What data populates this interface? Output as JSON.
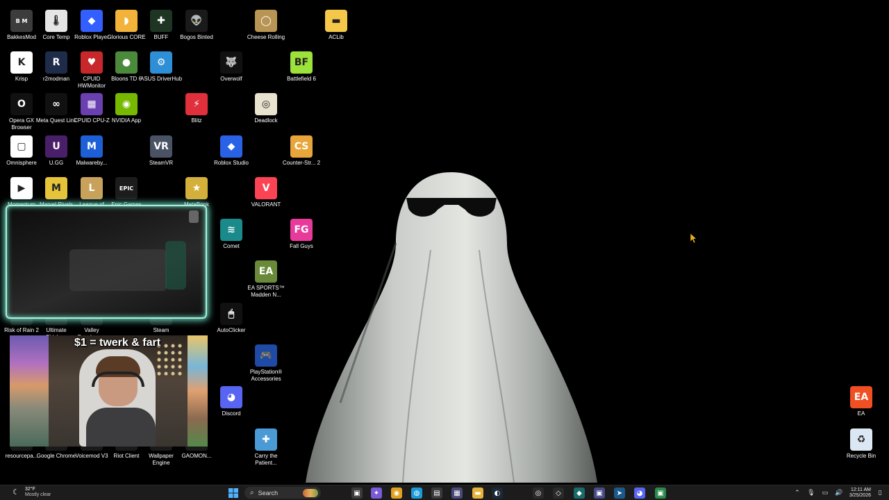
{
  "desktop": {
    "icons": [
      {
        "label": "BakkesMod",
        "glyph": "B M",
        "color": "#3c3c3c"
      },
      {
        "label": "Core Temp",
        "glyph": "🌡",
        "color": "#e5e5e5"
      },
      {
        "label": "Roblox Player",
        "glyph": "◆",
        "color": "#335fff"
      },
      {
        "label": "Glorious CORE",
        "glyph": "◗",
        "color": "#f3b23a"
      },
      {
        "label": "BUFF",
        "glyph": "✚",
        "color": "#1f3524"
      },
      {
        "label": "Bogos Binted",
        "glyph": "👽",
        "color": "#1a1a1a"
      },
      {
        "label": "Cheese Rolling",
        "glyph": "◯",
        "color": "#b89455"
      },
      {
        "label": "ACLib",
        "glyph": "▬",
        "color": "#f5c84a"
      },
      {
        "label": "Krisp",
        "glyph": "K",
        "color": "#ffffff"
      },
      {
        "label": "r2modman",
        "glyph": "R",
        "color": "#1e2c4a"
      },
      {
        "label": "CPUID HWMonitor",
        "glyph": "♥",
        "color": "#c8282b"
      },
      {
        "label": "Bloons TD 6",
        "glyph": "●",
        "color": "#4a8a3a"
      },
      {
        "label": "ASUS DriverHub",
        "glyph": "⚙",
        "color": "#2f8fd6"
      },
      {
        "label": "Overwolf",
        "glyph": "🐺",
        "color": "#111111"
      },
      {
        "label": "Battlefield 6",
        "glyph": "BF",
        "color": "#9de23a"
      },
      {
        "label": "Opera GX Browser",
        "glyph": "O",
        "color": "#111111"
      },
      {
        "label": "Meta Quest Link",
        "glyph": "∞",
        "color": "#111111"
      },
      {
        "label": "CPUID CPU-Z",
        "glyph": "▦",
        "color": "#6a3fb0"
      },
      {
        "label": "NVIDIA App",
        "glyph": "◉",
        "color": "#76b900"
      },
      {
        "label": "Blitz",
        "glyph": "⚡",
        "color": "#e0303c"
      },
      {
        "label": "Deadlock",
        "glyph": "◎",
        "color": "#e8e2cf"
      },
      {
        "label": "Omnisphere",
        "glyph": "▢",
        "color": "#ffffff"
      },
      {
        "label": "U.GG",
        "glyph": "U",
        "color": "#4a1f6a"
      },
      {
        "label": "Malwareby...",
        "glyph": "M",
        "color": "#1d5fd6"
      },
      {
        "label": "SteamVR",
        "glyph": "VR",
        "color": "#4a5364"
      },
      {
        "label": "Roblox Studio",
        "glyph": "◆",
        "color": "#2a62e6"
      },
      {
        "label": "Counter-Str... 2",
        "glyph": "CS",
        "color": "#e8a53a"
      },
      {
        "label": "Momentum",
        "glyph": "▶",
        "color": "#ffffff"
      },
      {
        "label": "Marvel Rivals",
        "glyph": "M",
        "color": "#e6c43a"
      },
      {
        "label": "League of",
        "glyph": "L",
        "color": "#c8a25a"
      },
      {
        "label": "Epic Games",
        "glyph": "EPIC",
        "color": "#1c1c1c"
      },
      {
        "label": "MetaBonk",
        "glyph": "★",
        "color": "#d4b03a"
      },
      {
        "label": "VALORANT",
        "glyph": "V",
        "color": "#fa4454"
      },
      {
        "label": "Comet",
        "glyph": "≋",
        "color": "#1a8a8a"
      },
      {
        "label": "Fall Guys",
        "glyph": "FG",
        "color": "#e83a9a"
      },
      {
        "label": "EA SPORTS™ Madden N...",
        "glyph": "EA",
        "color": "#6a8a3a"
      },
      {
        "label": "Risk of Rain 2",
        "glyph": "",
        "color": "#1a1a1a"
      },
      {
        "label": "Ultimate Chicke...",
        "glyph": "",
        "color": "#1a1a1a"
      },
      {
        "label": "Valley Benchma...",
        "glyph": "",
        "color": "#1a1a1a"
      },
      {
        "label": "Steam",
        "glyph": "",
        "color": "#1a1a1a"
      },
      {
        "label": "AutoClicker",
        "glyph": "🖱",
        "color": "#111111"
      },
      {
        "label": "PlayStation® Accessories",
        "glyph": "🎮",
        "color": "#1f4aa6"
      },
      {
        "label": "Discord",
        "glyph": "◕",
        "color": "#5865f2"
      },
      {
        "label": "Carry the Patient...",
        "glyph": "✚",
        "color": "#4a9ad6"
      },
      {
        "label": "resourcepa...",
        "glyph": "",
        "color": "#1a1a1a"
      },
      {
        "label": "Google Chrome",
        "glyph": "",
        "color": "#1a1a1a"
      },
      {
        "label": "Voicemod V3",
        "glyph": "",
        "color": "#1a1a1a"
      },
      {
        "label": "Riot Client",
        "glyph": "",
        "color": "#1a1a1a"
      },
      {
        "label": "Wallpaper Engine",
        "glyph": "",
        "color": "#1a1a1a"
      },
      {
        "label": "GAOMON...",
        "glyph": "",
        "color": "#1a1a1a"
      },
      {
        "label": "EA",
        "glyph": "EA",
        "color": "#f04e23"
      },
      {
        "label": "Recycle Bin",
        "glyph": "♻",
        "color": "#dbe7f2"
      }
    ]
  },
  "facecam": {
    "overlay_text": "$1 = twerk & fart"
  },
  "taskbar": {
    "weather_temp": "32°F",
    "weather_desc": "Mostly clear",
    "search_placeholder": "Search",
    "pinned": [
      {
        "name": "task-view",
        "glyph": "▣",
        "color": "#3b3b3b"
      },
      {
        "name": "copilot",
        "glyph": "✦",
        "color": "#7a5ad6"
      },
      {
        "name": "chrome",
        "glyph": "◉",
        "color": "#e0a020"
      },
      {
        "name": "edge",
        "glyph": "◍",
        "color": "#1a9ad6"
      },
      {
        "name": "notepad",
        "glyph": "▤",
        "color": "#3a3a3a"
      },
      {
        "name": "app",
        "glyph": "▦",
        "color": "#4a4a7a"
      },
      {
        "name": "file-explorer",
        "glyph": "▬",
        "color": "#e6b23a"
      },
      {
        "name": "steam",
        "glyph": "◐",
        "color": "#1b2838"
      },
      {
        "name": "obs",
        "glyph": "◎",
        "color": "#2a2a2a"
      },
      {
        "name": "app-2",
        "glyph": "◇",
        "color": "#2a2a2a"
      },
      {
        "name": "app-3",
        "glyph": "◆",
        "color": "#1a6a6a"
      },
      {
        "name": "app-4",
        "glyph": "▣",
        "color": "#4a4a8a"
      },
      {
        "name": "app-5",
        "glyph": "➤",
        "color": "#1a5a8a"
      },
      {
        "name": "discord",
        "glyph": "◕",
        "color": "#5865f2"
      },
      {
        "name": "app-6",
        "glyph": "▣",
        "color": "#2a8a4a"
      }
    ],
    "clock_time": "12:11 AM",
    "clock_date": "3/25/2026"
  }
}
